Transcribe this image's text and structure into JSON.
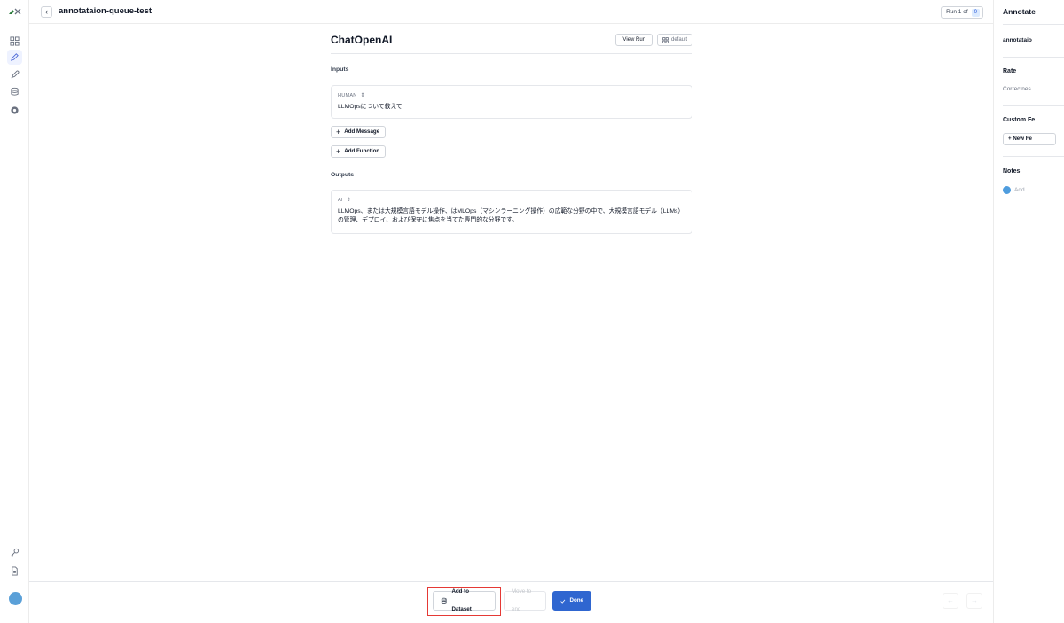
{
  "header": {
    "back_icon": "chevron-left-icon",
    "queue_title": "annotataion-queue-test",
    "run_counter_label": "Run 1 of",
    "run_counter_total": "0"
  },
  "sidebar": {
    "items": [
      {
        "icon": "grid-icon",
        "active": false
      },
      {
        "icon": "pencil-icon",
        "active": true
      },
      {
        "icon": "rocket-icon",
        "active": false
      },
      {
        "icon": "database-icon",
        "active": false
      },
      {
        "icon": "globe-icon",
        "active": false
      }
    ],
    "bottom_items": [
      {
        "icon": "key-icon"
      },
      {
        "icon": "document-icon"
      },
      {
        "icon": "avatar"
      }
    ]
  },
  "run": {
    "name": "ChatOpenAI",
    "view_run_label": "View Run",
    "view_mode_label": "default",
    "inputs_label": "Inputs",
    "input_message": {
      "role": "HUMAN",
      "text": "LLMOpsについて教えて"
    },
    "add_message_label": "Add Message",
    "add_function_label": "Add Function",
    "outputs_label": "Outputs",
    "output_message": {
      "role": "AI",
      "text": "LLMOps、または大規模言語モデル操作、はMLOps（マシンラーニング操作）の広範な分野の中で、大規模言語モデル（LLMs）の管理、デプロイ、および保守に焦点を当てた専門的な分野です。"
    }
  },
  "right_panel": {
    "title": "Annotate",
    "queue_name": "annotataio",
    "rate_label": "Rate",
    "rate_item": "Correctnes",
    "custom_feedback_label": "Custom Fe",
    "new_feedback_label": "+ New Fe",
    "notes_label": "Notes",
    "notes_placeholder": "Add"
  },
  "footer": {
    "add_to_dataset_label": "Add to Dataset",
    "move_to_end_label": "Move to end",
    "done_label": "Done"
  },
  "colors": {
    "accent": "#2f66d0",
    "highlight": "#e53935",
    "avatar": "#5aa0d8"
  }
}
